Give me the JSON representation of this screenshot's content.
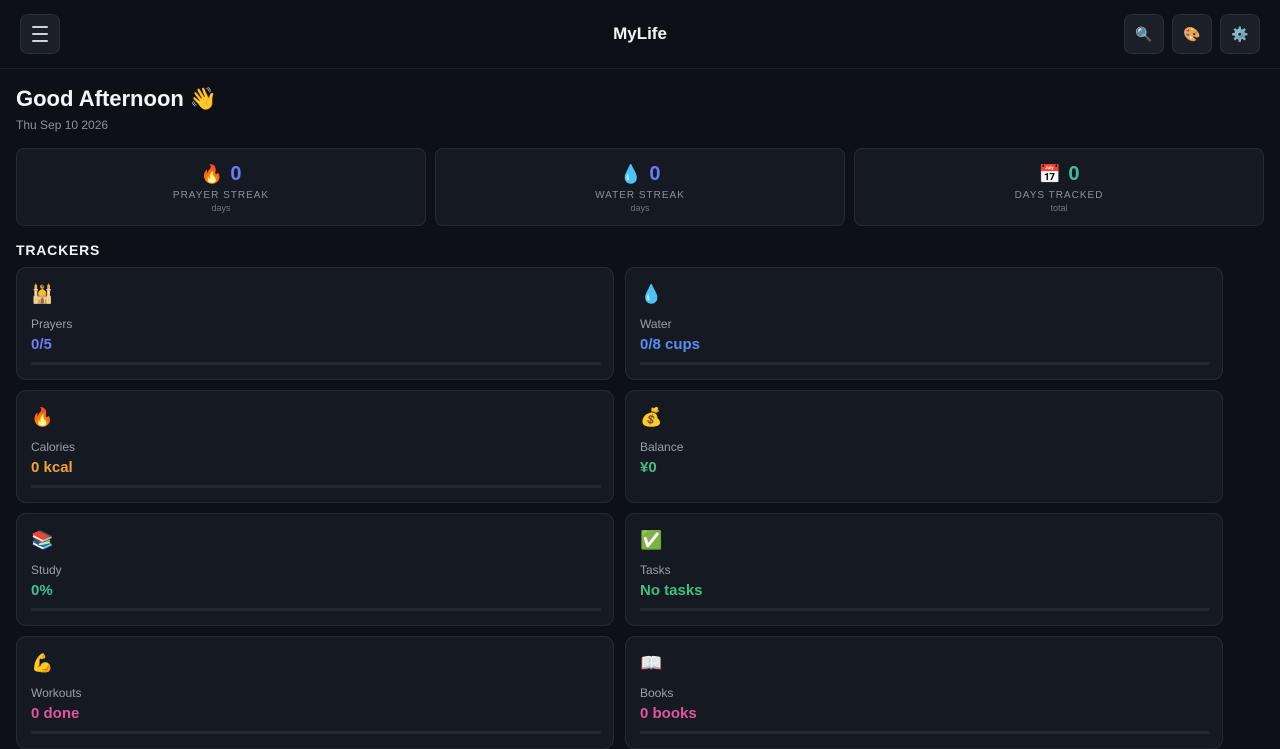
{
  "header": {
    "title": "MyLife",
    "menu_icon": "hamburger-icon",
    "search_icon": "🔍",
    "theme_icon": "🎨",
    "settings_icon": "⚙️"
  },
  "greeting": {
    "text": "Good Afternoon 👋",
    "date": "Thu Sep 10 2026"
  },
  "stats": [
    {
      "emoji": "🔥",
      "value": "0",
      "label": "PRAYER STREAK",
      "sub": "days",
      "color": "#6b7cf5"
    },
    {
      "emoji": "💧",
      "value": "0",
      "label": "WATER STREAK",
      "sub": "days",
      "color": "#6b7cf5"
    },
    {
      "emoji": "📅",
      "value": "0",
      "label": "DAYS TRACKED",
      "sub": "total",
      "color": "#3fbf98"
    }
  ],
  "trackers_title": "TRACKERS",
  "trackers": [
    {
      "emoji": "🕌",
      "label": "Prayers",
      "value": "0/5",
      "color": "#6b7cf5",
      "progress": 0,
      "has_bar": true
    },
    {
      "emoji": "💧",
      "label": "Water",
      "value": "0/8 cups",
      "color": "#5b8cf0",
      "progress": 0,
      "has_bar": true
    },
    {
      "emoji": "🔥",
      "label": "Calories",
      "value": "0 kcal",
      "color": "#f0a23a",
      "progress": 0,
      "has_bar": true
    },
    {
      "emoji": "💰",
      "label": "Balance",
      "value": "¥0",
      "color": "#3fbf80",
      "progress": 0,
      "has_bar": false
    },
    {
      "emoji": "📚",
      "label": "Study",
      "value": "0%",
      "color": "#3fbf98",
      "progress": 0,
      "has_bar": true
    },
    {
      "emoji": "✅",
      "label": "Tasks",
      "value": "No tasks",
      "color": "#3fbf80",
      "progress": 0,
      "has_bar": true
    },
    {
      "emoji": "💪",
      "label": "Workouts",
      "value": "0 done",
      "color": "#e0559a",
      "progress": 0,
      "has_bar": true
    },
    {
      "emoji": "📖",
      "label": "Books",
      "value": "0 books",
      "color": "#e0559a",
      "progress": 0,
      "has_bar": true
    }
  ]
}
